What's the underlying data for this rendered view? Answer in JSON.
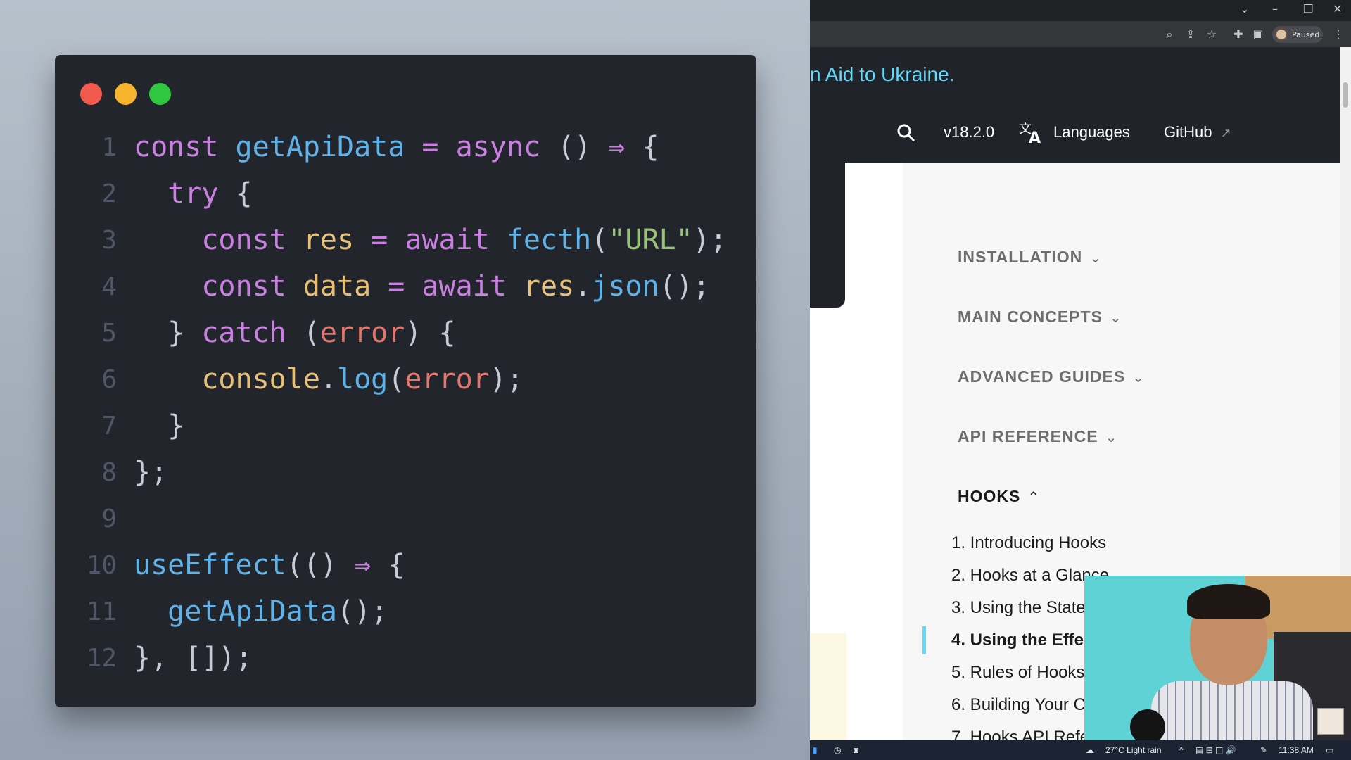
{
  "code_window": {
    "lines": [
      {
        "n": "1",
        "tokens": [
          [
            "kw",
            "const "
          ],
          [
            "fn",
            "getApiData"
          ],
          [
            "op",
            " = "
          ],
          [
            "kw",
            "async"
          ],
          [
            "pun",
            " () "
          ],
          [
            "op",
            "⇒"
          ],
          [
            "pun",
            " {"
          ]
        ]
      },
      {
        "n": "2",
        "tokens": [
          [
            "kw",
            "  try"
          ],
          [
            "pun",
            " {"
          ]
        ]
      },
      {
        "n": "3",
        "tokens": [
          [
            "kw",
            "    const "
          ],
          [
            "var",
            "res"
          ],
          [
            "op",
            " = "
          ],
          [
            "kw",
            "await "
          ],
          [
            "fn",
            "fecth"
          ],
          [
            "pun",
            "("
          ],
          [
            "str",
            "\"URL\""
          ],
          [
            "pun",
            ");"
          ]
        ]
      },
      {
        "n": "4",
        "tokens": [
          [
            "kw",
            "    const "
          ],
          [
            "var",
            "data"
          ],
          [
            "op",
            " = "
          ],
          [
            "kw",
            "await "
          ],
          [
            "var",
            "res"
          ],
          [
            "pun",
            "."
          ],
          [
            "fn",
            "json"
          ],
          [
            "pun",
            "();"
          ]
        ]
      },
      {
        "n": "5",
        "tokens": [
          [
            "pun",
            "  } "
          ],
          [
            "kw",
            "catch"
          ],
          [
            "pun",
            " ("
          ],
          [
            "err",
            "error"
          ],
          [
            "pun",
            ") {"
          ]
        ]
      },
      {
        "n": "6",
        "tokens": [
          [
            "var",
            "    console"
          ],
          [
            "pun",
            "."
          ],
          [
            "fn",
            "log"
          ],
          [
            "pun",
            "("
          ],
          [
            "err",
            "error"
          ],
          [
            "pun",
            ");"
          ]
        ]
      },
      {
        "n": "7",
        "tokens": [
          [
            "pun",
            "  }"
          ]
        ]
      },
      {
        "n": "8",
        "tokens": [
          [
            "pun",
            "};"
          ]
        ]
      },
      {
        "n": "9",
        "tokens": []
      },
      {
        "n": "10",
        "tokens": [
          [
            "fn",
            "useEffect"
          ],
          [
            "pun",
            "(() "
          ],
          [
            "op",
            "⇒"
          ],
          [
            "pun",
            " {"
          ]
        ]
      },
      {
        "n": "11",
        "tokens": [
          [
            "fn",
            "  getApiData"
          ],
          [
            "pun",
            "();"
          ]
        ]
      },
      {
        "n": "12",
        "tokens": [
          [
            "pun",
            "}, []);"
          ]
        ]
      }
    ]
  },
  "browser": {
    "toolbar": {
      "profile_label": "Paused"
    },
    "banner": "n Aid to Ukraine.",
    "nav": {
      "version": "v18.2.0",
      "languages": "Languages",
      "github": "GitHub"
    },
    "sidebar": {
      "sections": [
        "INSTALLATION",
        "MAIN CONCEPTS",
        "ADVANCED GUIDES",
        "API REFERENCE"
      ],
      "active_section": "HOOKS",
      "hooks": [
        "1. Introducing Hooks",
        "2. Hooks at a Glance",
        "3. Using the State",
        "4. Using the Effe",
        "5. Rules of Hooks",
        "6. Building Your C",
        "7. Hooks API Refe"
      ]
    }
  },
  "taskbar": {
    "weather": "27°C  Light rain",
    "time": "11:38 AM"
  },
  "colors": {
    "accent": "#61dafb",
    "code_bg": "#22252c",
    "header_bg": "#20232a"
  }
}
